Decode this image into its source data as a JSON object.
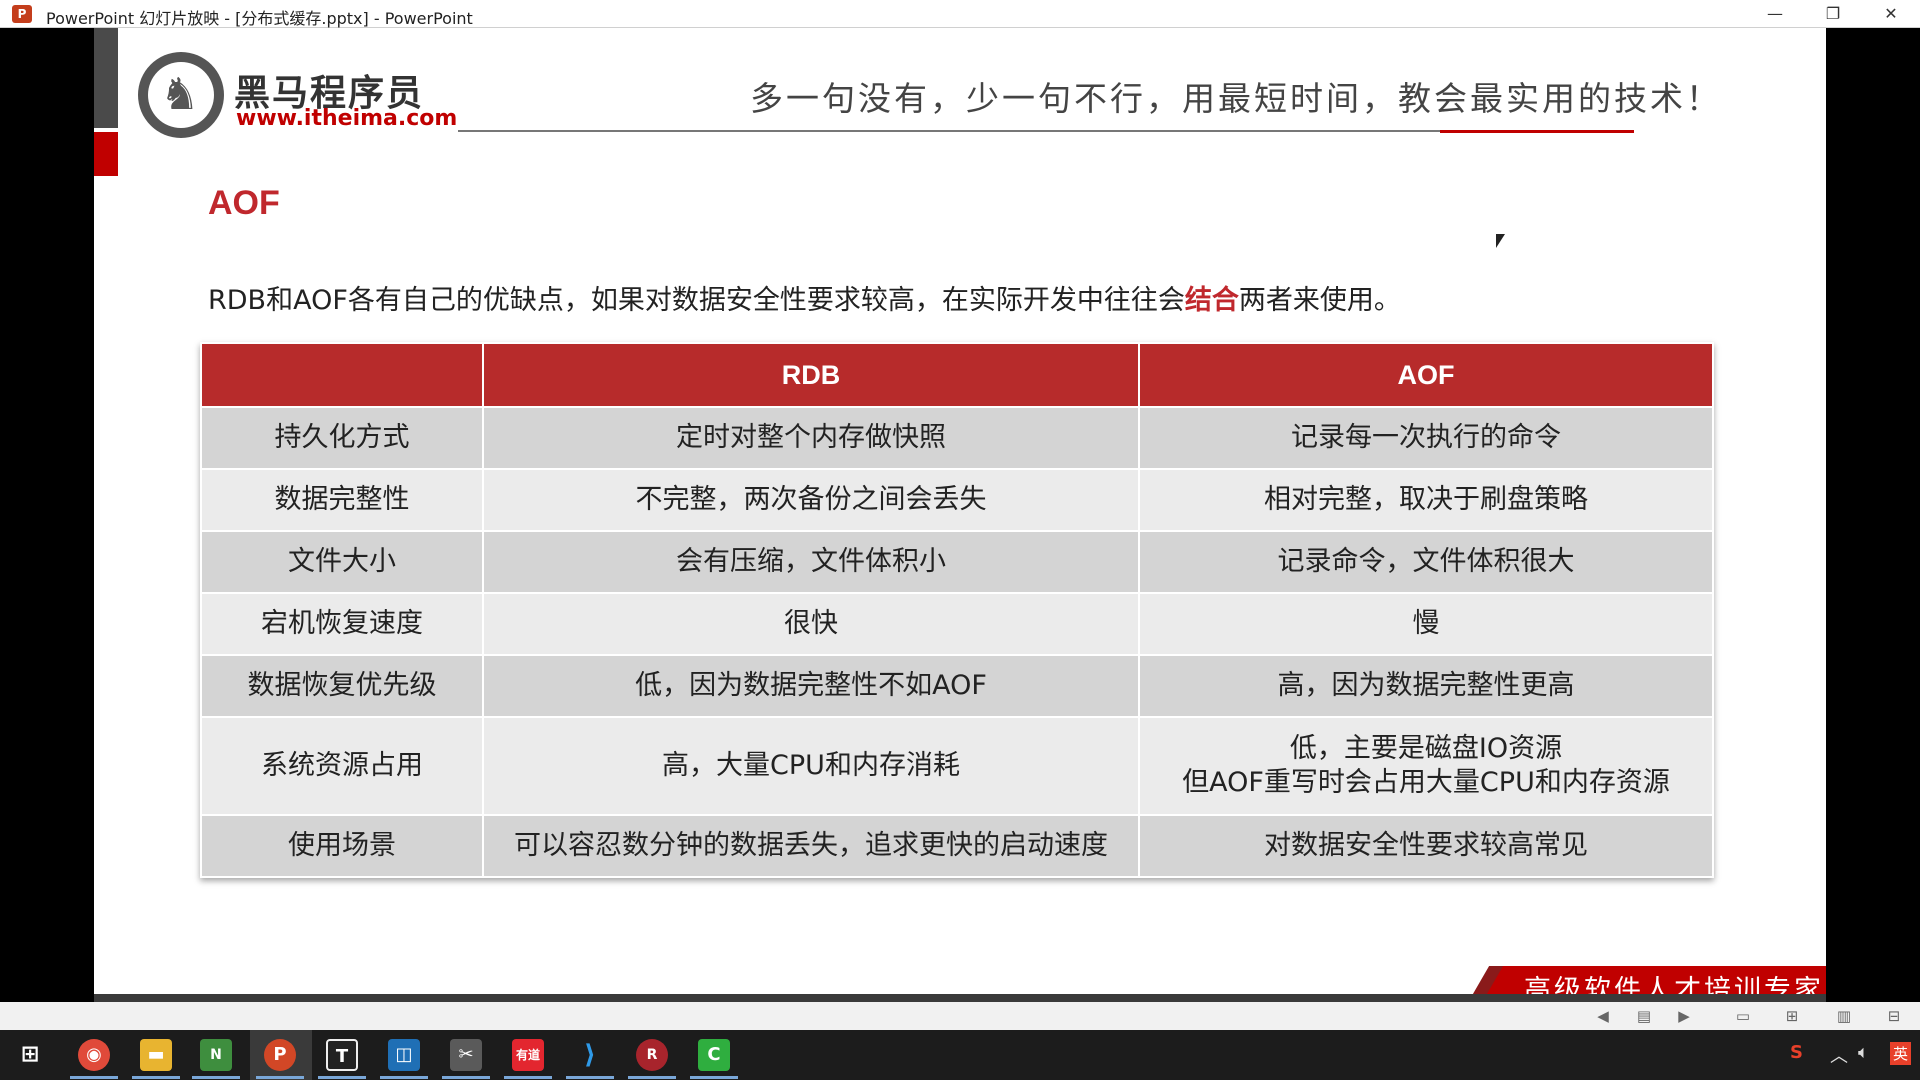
{
  "window": {
    "title": "PowerPoint 幻灯片放映 - [分布式缓存.pptx] - PowerPoint",
    "app_icon": "P",
    "minimize": "—",
    "restore": "❐",
    "close": "✕"
  },
  "slide": {
    "logo_cn": "黑马程序员",
    "logo_url": "www.itheima.com",
    "slogan": "多一句没有，少一句不行，用最短时间，教会最实用的技术！",
    "title": "AOF",
    "intro_before": "RDB和AOF各有自己的优缺点，如果对数据安全性要求较高，在实际开发中往往会",
    "intro_highlight": "结合",
    "intro_after": "两者来使用。",
    "footer": "高级软件人才培训专家",
    "accent_color": "#c00000"
  },
  "table": {
    "headers": [
      "",
      "RDB",
      "AOF"
    ],
    "rows": [
      [
        "持久化方式",
        "定时对整个内存做快照",
        "记录每一次执行的命令"
      ],
      [
        "数据完整性",
        "不完整，两次备份之间会丢失",
        "相对完整，取决于刷盘策略"
      ],
      [
        "文件大小",
        "会有压缩，文件体积小",
        "记录命令，文件体积很大"
      ],
      [
        "宕机恢复速度",
        "很快",
        "慢"
      ],
      [
        "数据恢复优先级",
        "低，因为数据完整性不如AOF",
        "高，因为数据完整性更高"
      ],
      [
        "系统资源占用",
        "高，大量CPU和内存消耗",
        "低，主要是磁盘IO资源\n但AOF重写时会占用大量CPU和内存资源"
      ],
      [
        "使用场景",
        "可以容忍数分钟的数据丢失，追求更快的启动速度",
        "对数据安全性要求较高常见"
      ]
    ]
  },
  "taskbar": {
    "icons": [
      "windows-start",
      "chrome",
      "file-explorer",
      "notepad-plus",
      "powerpoint",
      "typora",
      "virtualbox",
      "snipping-tool",
      "youdao",
      "vscode",
      "redis-desktop",
      "camtasia"
    ],
    "tray_ime": "英"
  }
}
